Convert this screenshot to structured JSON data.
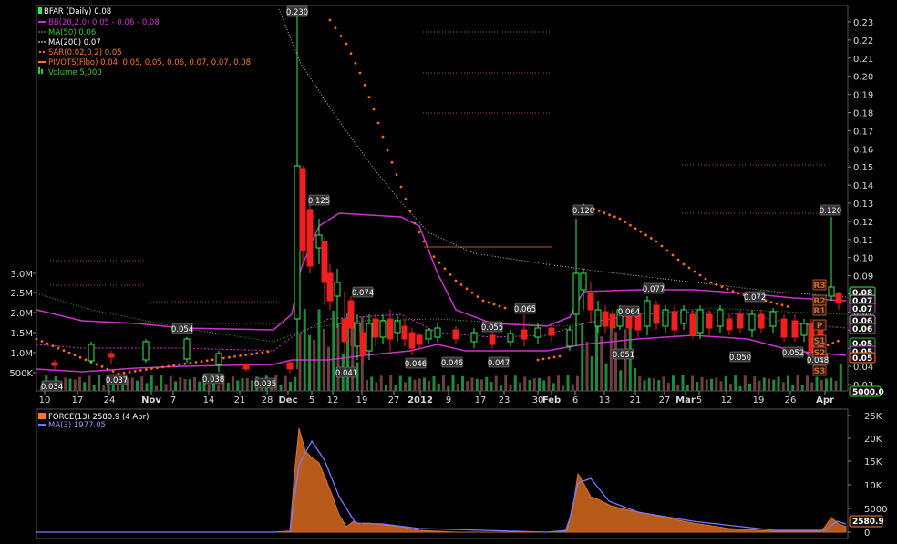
{
  "title": "BFAR (Daily) 0.08",
  "legend_main": [
    {
      "text": "BB(20,2.0) 0.05 - 0.06 - 0.08",
      "color": "#cc33cc"
    },
    {
      "text": "MA(50) 0.06",
      "color": "#33cc33"
    },
    {
      "text": "MA(200) 0.07",
      "color": "#ffffff"
    },
    {
      "text": "SAR(0.02,0.2) 0.05",
      "color": "#ff7722"
    },
    {
      "text": "PIVOTS(Fibo) 0.04, 0.05, 0.05, 0.06, 0.07, 0.07, 0.08",
      "color": "#ff7722"
    },
    {
      "text": "Volume 5,000",
      "color": "#33cc33"
    }
  ],
  "legend_lower": [
    {
      "text": "FORCE(13) 2580.9 (4 Apr)",
      "color": "#ff7722"
    },
    {
      "text": "MA(3) 1977.05",
      "color": "#7777ff"
    }
  ],
  "colors": {
    "up": "#33ee55",
    "down": "#ee2020",
    "bb": "#cc33cc",
    "sar": "#ff6a1a",
    "ma200": "#bbbbbb",
    "force": "#b85a1a",
    "force_ma": "#7a7aff",
    "volume_up": "#1f8a3a",
    "volume_down": "#6a4040"
  },
  "x_ticks": [
    "10",
    "17",
    "24",
    "Nov",
    "7",
    "14",
    "21",
    "28",
    "Dec",
    "5",
    "12",
    "19",
    "27",
    "2012",
    "9",
    "17",
    "23",
    "30",
    "Feb",
    "6",
    "13",
    "21",
    "27",
    "Mar",
    "5",
    "12",
    "19",
    "26",
    "Apr"
  ],
  "price_ticks": [
    "0.23",
    "0.22",
    "0.21",
    "0.20",
    "0.19",
    "0.18",
    "0.17",
    "0.16",
    "0.15",
    "0.14",
    "0.13",
    "0.12",
    "0.11",
    "0.10",
    "0.09",
    "0.08",
    "0.07",
    "0.06",
    "0.05",
    "0.04",
    "0.03"
  ],
  "volume_ticks": [
    "3.0M",
    "2.5M",
    "2.0M",
    "1.5M",
    "1.0M",
    "500K"
  ],
  "force_ticks": [
    "25K",
    "20K",
    "15K",
    "10K",
    "5000",
    "0"
  ],
  "callouts": [
    "0.230",
    "0.125",
    "0.074",
    "0.054",
    "0.034",
    "0.037",
    "0.038",
    "0.035",
    "0.041",
    "0.046",
    "0.046",
    "0.047",
    "0.055",
    "0.065",
    "0.120",
    "0.051",
    "0.064",
    "0.077",
    "0.072",
    "0.050",
    "0.052",
    "0.048",
    "0.120"
  ],
  "pivot_labels": [
    "R3",
    "R2",
    "R1",
    "P",
    "S1",
    "S2",
    "S3"
  ],
  "right_labels": {
    "last": "0.08",
    "v1": "0.07",
    "v2": "0.07",
    "v3": "0.06",
    "v4": "0.06",
    "v5": "0.05",
    "v6": "0.05",
    "v7": "0.05",
    "volume": "5000.0",
    "force": "2580.9"
  },
  "chart_data": [
    {
      "type": "candlestick",
      "title": "BFAR (Daily) 0.08",
      "ylim": [
        0.026,
        0.237
      ],
      "series": [
        {
          "name": "BB(20,2.0)",
          "values": [
            0.05,
            0.06,
            0.08
          ]
        },
        {
          "name": "MA(50)",
          "values": [
            0.06
          ]
        },
        {
          "name": "MA(200)",
          "values": [
            0.07
          ]
        },
        {
          "name": "SAR(0.02,0.2)",
          "values": [
            0.05
          ]
        },
        {
          "name": "PIVOTS(Fibo)",
          "values": [
            0.04,
            0.05,
            0.05,
            0.06,
            0.07,
            0.07,
            0.08
          ]
        },
        {
          "name": "Volume",
          "values": [
            5000
          ]
        }
      ],
      "annotations": [
        0.23,
        0.125,
        0.074,
        0.054,
        0.034,
        0.037,
        0.038,
        0.035,
        0.041,
        0.046,
        0.046,
        0.047,
        0.055,
        0.065,
        0.12,
        0.051,
        0.064,
        0.077,
        0.072,
        0.05,
        0.052,
        0.048,
        0.12
      ]
    },
    {
      "type": "area",
      "series": [
        {
          "name": "FORCE(13)",
          "values": [
            2580.9
          ]
        },
        {
          "name": "MA(3)",
          "values": [
            1977.05
          ]
        }
      ],
      "ylim": [
        0,
        27000
      ],
      "grid": false
    }
  ]
}
